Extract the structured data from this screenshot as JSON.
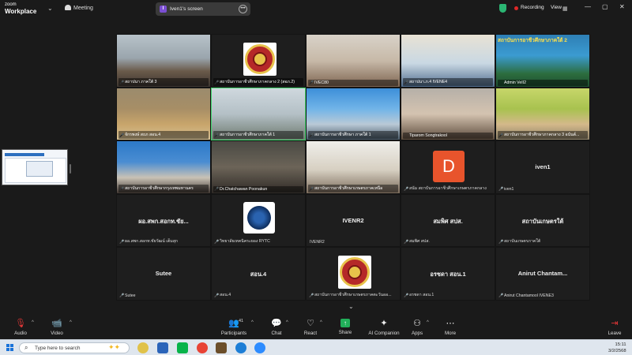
{
  "app": {
    "logo_line1": "zoom",
    "logo_line2": "Workplace",
    "meeting_label": "Meeting"
  },
  "share": {
    "badge": "I",
    "label": "Iven1's screen"
  },
  "status": {
    "recording": "Recording",
    "view": "View"
  },
  "tiles": [
    {
      "label": "สถาปนา ภาคใต้ 3",
      "muted": true
    },
    {
      "label": "สถาบันการอาชีวศึกษาภาคกลาง 2 (สอภ.2)",
      "muted": true
    },
    {
      "label": "IVEC80",
      "muted": true
    },
    {
      "label": "สถาปนา.ภ.4 IVENE4",
      "muted": true
    },
    {
      "label": "Admin VeII2",
      "muted": false,
      "overlay": "สถาบันการอาชีวศึกษาภาคใต้ 2"
    },
    {
      "label": "จักรพงษ์ สถภ สอน.4",
      "muted": true
    },
    {
      "label": "สถาบันการอาชีวศึกษาภาคใต้ 1",
      "muted": true
    },
    {
      "label": "สถาบันการอาชีวศึกษา ภาคใต้ 1",
      "muted": true
    },
    {
      "label": "Tiparom Songtrakool",
      "muted": false
    },
    {
      "label": "สถาบันการอาชีวศึกษาภาคกลาง 3 อนันต์...",
      "muted": true
    },
    {
      "label": "สถาบันการอาชีวศึกษากรุงเทพมหานคร",
      "muted": true
    },
    {
      "label": "Dr.Chatchawan Poonakun",
      "muted": true
    },
    {
      "label": "สถาบันการอาชีวศึกษาเกษตรภาคเหนือ",
      "muted": true
    },
    {
      "label": "สนัม สถาบันการอาชีวศึกษาเกษตรภาคกลาง",
      "muted": true,
      "avatar": "D"
    },
    {
      "label": "iven1",
      "muted": true,
      "name": "iven1"
    },
    {
      "label": "ผอ.สพก.สอกท.ชัยวัฒน์ เต็มสุก",
      "muted": true,
      "name": "ผอ.สพก.สอกท.ชัย..."
    },
    {
      "label": "วิทยาลัยเทคนิคระยอง RYTC",
      "muted": true
    },
    {
      "label": "IVENR2",
      "muted": false,
      "name": "IVENR2"
    },
    {
      "label": "สมพิศ สปส.",
      "muted": true,
      "name": "สมพิศ สปส."
    },
    {
      "label": "สถาบันเกษตรภาคใต้",
      "muted": true,
      "name": "สถาบันเกษตรใต้"
    },
    {
      "label": "Sutee",
      "muted": true,
      "name": "Sutee"
    },
    {
      "label": "สอน.4",
      "muted": true,
      "name": "สอน.4"
    },
    {
      "label": "สถาบันการอาชีวศึกษาเกษตรภาคตะวันออ...",
      "muted": true
    },
    {
      "label": "อรชดา สอน.1",
      "muted": true,
      "name": "อรชดา สอน.1"
    },
    {
      "label": "Anirut Chantamool IVENE3",
      "muted": true,
      "name": "Anirut  Chantam..."
    }
  ],
  "toolbar": {
    "audio": "Audio",
    "video": "Video",
    "participants": "Participants",
    "participants_count": "41",
    "chat": "Chat",
    "react": "React",
    "share": "Share",
    "ai_companion": "AI Companion",
    "apps": "Apps",
    "more": "More",
    "leave": "Leave"
  },
  "taskbar": {
    "search_placeholder": "Type here to search",
    "time": "15:11",
    "date": "3/2/2568"
  },
  "colors": {
    "active_speaker": "#3fd36b",
    "recording": "#e02828",
    "muted": "#e03030"
  }
}
